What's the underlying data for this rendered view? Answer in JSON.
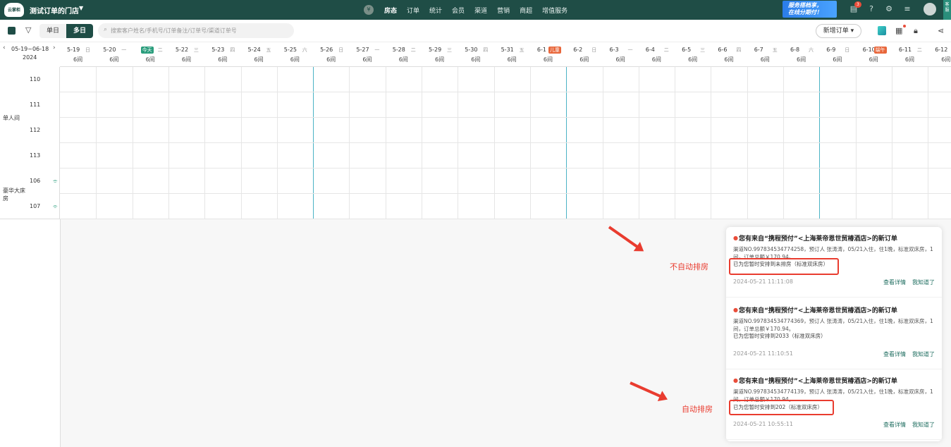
{
  "app": {
    "logo_text": "云掌柜",
    "store_name": "测试订单的门店"
  },
  "nav": {
    "logo_glyph": "¥",
    "items": [
      "房态",
      "订单",
      "统计",
      "会员",
      "渠道",
      "营销",
      "商超",
      "增值服务"
    ],
    "active": "房态"
  },
  "promo": {
    "line1": "服务搭档享，",
    "line2": "在线分期付！"
  },
  "notification_count": "3",
  "side_tab": "客服",
  "toolbar": {
    "single_day": "单日",
    "multi_day": "多日",
    "search_placeholder": "搜索客户姓名/手机号/订单备注/订单号/渠道订单号",
    "new_order": "新增订单 ▾"
  },
  "date_range": {
    "label": "05-19~06-18",
    "year": "2024"
  },
  "dates": [
    {
      "date": "5-19",
      "week": "日",
      "count": "6间"
    },
    {
      "date": "5-20",
      "week": "一",
      "count": "6间"
    },
    {
      "date": "",
      "week": "二",
      "count": "6间",
      "badge": "今天"
    },
    {
      "date": "5-22",
      "week": "三",
      "count": "6间"
    },
    {
      "date": "5-23",
      "week": "四",
      "count": "6间"
    },
    {
      "date": "5-24",
      "week": "五",
      "count": "6间"
    },
    {
      "date": "5-25",
      "week": "六",
      "count": "6间"
    },
    {
      "date": "5-26",
      "week": "日",
      "count": "6间"
    },
    {
      "date": "5-27",
      "week": "一",
      "count": "6间"
    },
    {
      "date": "5-28",
      "week": "二",
      "count": "6间"
    },
    {
      "date": "5-29",
      "week": "三",
      "count": "6间"
    },
    {
      "date": "5-30",
      "week": "四",
      "count": "6间"
    },
    {
      "date": "5-31",
      "week": "五",
      "count": "6间"
    },
    {
      "date": "6-1",
      "week": "",
      "count": "6间",
      "badge": "儿童"
    },
    {
      "date": "6-2",
      "week": "日",
      "count": "6间"
    },
    {
      "date": "6-3",
      "week": "一",
      "count": "6间"
    },
    {
      "date": "6-4",
      "week": "二",
      "count": "6间"
    },
    {
      "date": "6-5",
      "week": "三",
      "count": "6间"
    },
    {
      "date": "6-6",
      "week": "四",
      "count": "6间"
    },
    {
      "date": "6-7",
      "week": "五",
      "count": "6间"
    },
    {
      "date": "6-8",
      "week": "六",
      "count": "6间"
    },
    {
      "date": "6-9",
      "week": "日",
      "count": "6间"
    },
    {
      "date": "6-10",
      "week": "",
      "count": "6间",
      "badge": "端午"
    },
    {
      "date": "6-11",
      "week": "二",
      "count": "6间"
    },
    {
      "date": "6-12",
      "week": "",
      "count": "6间"
    }
  ],
  "room_types": [
    {
      "name": "单人间",
      "rooms": [
        "110",
        "111",
        "112",
        "113"
      ]
    },
    {
      "name": "豪华大床房",
      "rooms": [
        "106",
        "107"
      ]
    }
  ],
  "annotations": {
    "not_auto": "不自动排房",
    "auto": "自动排房"
  },
  "notifications": [
    {
      "title": "您有来自“携程预付”<上海莱帝恩世贸椿酒店>的新订单",
      "body": "渠道NO.997834534774258，预订人 张涛涛，05/21入住，住1晚，标准双床房，1间，订单总额￥170.94。",
      "assign": "已为您暂时安排到未排房（标准双床房）",
      "time": "2024-05-21 11:11:08",
      "detail": "查看详情",
      "ack": "我知道了"
    },
    {
      "title": "您有来自“携程预付”<上海莱帝恩世贸椿酒店>的新订单",
      "body": "渠道NO.997834534774369，预订人 张涛涛，05/21入住，住1晚，标准双床房，1间，订单总额￥170.94。",
      "assign": "已为您暂时安排到2033（标准双床房）",
      "time": "2024-05-21 11:10:51",
      "detail": "查看详情",
      "ack": "我知道了"
    },
    {
      "title": "您有来自“携程预付”<上海莱帝恩世贸椿酒店>的新订单",
      "body": "渠道NO.997834534774139，预订人 张涛涛，05/21入住，住1晚，标准双床房，1间，订单总额￥170.94。",
      "assign": "已为您暂时安排到202（标准双床房）",
      "time": "2024-05-21 10:55:11",
      "detail": "查看详情",
      "ack": "我知道了"
    }
  ],
  "colors": {
    "brand": "#1f4d46",
    "accent_line": "#4bb3c5",
    "annotation": "#e93c2f",
    "today_badge": "#2a9d7c",
    "holiday_badge": "#e8663a"
  }
}
